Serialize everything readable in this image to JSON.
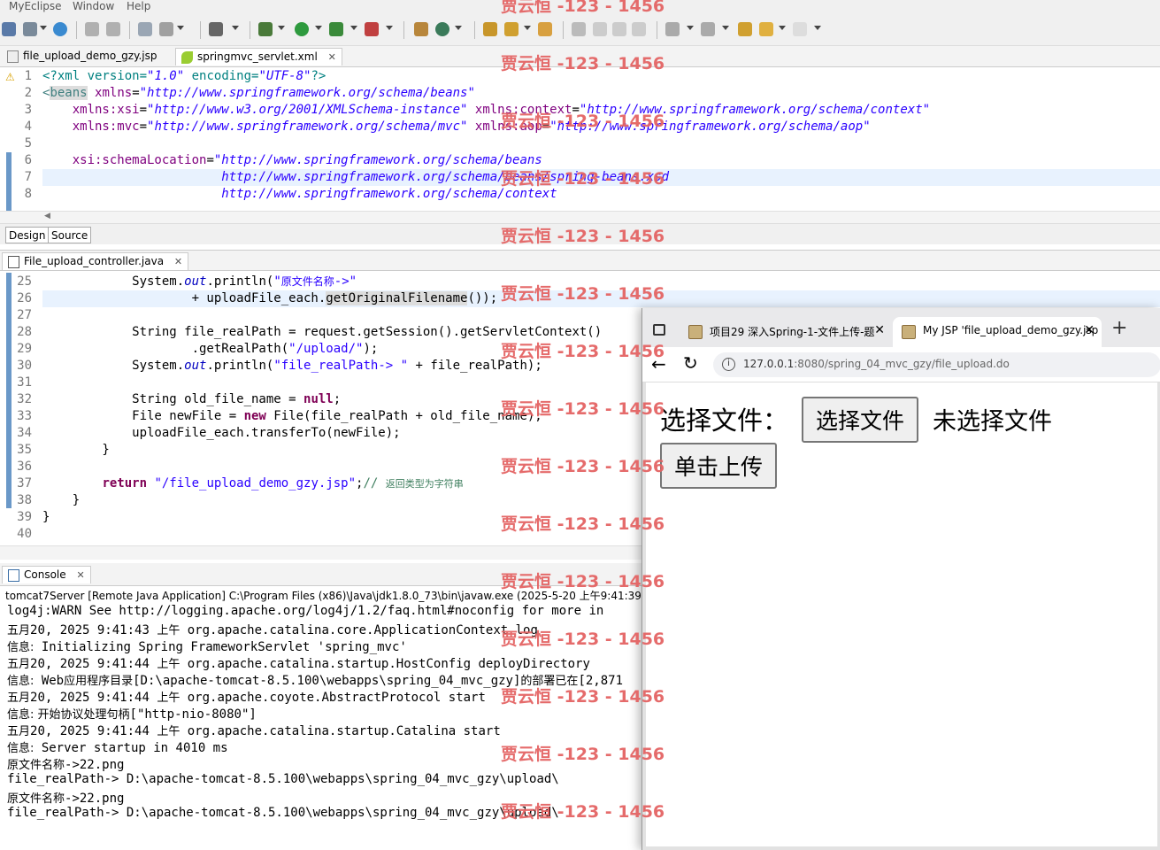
{
  "menubar": {
    "items": [
      "MyEclipse",
      "Window",
      "Help"
    ]
  },
  "xml_editor": {
    "tabs": [
      {
        "label": "file_upload_demo_gzy.jsp",
        "active": false
      },
      {
        "label": "springmvc_servlet.xml",
        "active": true
      }
    ],
    "lines": [
      {
        "n": "1",
        "html": "<span class=\"xdecl\">&lt;?xml version=</span><span class=\"xval\">\"1.0\"</span><span class=\"xdecl\"> encoding=</span><span class=\"xval\">\"UTF-8\"</span><span class=\"xdecl\">?&gt;</span>"
      },
      {
        "n": "2",
        "html": "<span class=\"xtag\">&lt;</span><span class=\"xtag\" style=\"background:#ddd\">beans</span> <span class=\"xattr\">xmlns</span>=<span class=\"xval\">\"http://www.springframework.org/schema/beans\"</span>"
      },
      {
        "n": "3",
        "html": "    <span class=\"xattr\">xmlns:xsi</span>=<span class=\"xval\">\"http://www.w3.org/2001/XMLSchema-instance\"</span> <span class=\"xattr\">xmlns:context</span>=<span class=\"xval\">\"http://www.springframework.org/schema/context\"</span>"
      },
      {
        "n": "4",
        "html": "    <span class=\"xattr\">xmlns:mvc</span>=<span class=\"xval\">\"http://www.springframework.org/schema/mvc\"</span> <span class=\"xattr\">xmlns:aop</span>=<span class=\"xval\">\"http://www.springframework.org/schema/aop\"</span>"
      },
      {
        "n": "5",
        "html": ""
      },
      {
        "n": "6",
        "html": "    <span class=\"xattr\">xsi:schemaLocation</span>=<span class=\"xval\">\"http://www.springframework.org/schema/beans</span>"
      },
      {
        "n": "7",
        "html": "                        <span class=\"xval\">http://www.springframework.org/schema/beans/spring-beans.xsd</span>"
      },
      {
        "n": "8",
        "html": "                        <span class=\"xval\">http://www.springframework.org/schema/context</span>"
      }
    ],
    "bottom_tabs": [
      "Design",
      "Source"
    ]
  },
  "java_editor": {
    "tab_label": "File_upload_controller.java",
    "lines": [
      {
        "n": "25",
        "html": "            System.<span class=\"fld\">out</span>.println(<span class=\"str\">\"<span class=\"cjk\">原文件名称</span>-&gt;\"</span>"
      },
      {
        "n": "26",
        "html": "                    + uploadFile_each.<span style=\"background:#ddd\">getOriginalFilename</span>());"
      },
      {
        "n": "27",
        "html": ""
      },
      {
        "n": "28",
        "html": "            String file_realPath = request.getSession().getServletContext()"
      },
      {
        "n": "29",
        "html": "                    .getRealPath(<span class=\"str\">\"/upload/\"</span>);"
      },
      {
        "n": "30",
        "html": "            System.<span class=\"fld\">out</span>.println(<span class=\"str\">\"file_realPath-&gt; \"</span> + file_realPath);"
      },
      {
        "n": "31",
        "html": ""
      },
      {
        "n": "32",
        "html": "            String old_file_name = <span class=\"kw\">null</span>;"
      },
      {
        "n": "33",
        "html": "            File newFile = <span class=\"kw\">new</span> File(file_realPath + old_file_name);"
      },
      {
        "n": "34",
        "html": "            uploadFile_each.transferTo(newFile);"
      },
      {
        "n": "35",
        "html": "        }"
      },
      {
        "n": "36",
        "html": ""
      },
      {
        "n": "37",
        "html": "        <span class=\"kw\">return</span> <span class=\"str\">\"/file_upload_demo_gzy.jsp\"</span>;<span class=\"cmt\">// <span class=\"cjk\" style=\"font-size:11px\">返回类型为字符串</span></span>"
      },
      {
        "n": "38",
        "html": "    }"
      },
      {
        "n": "39",
        "html": "}"
      },
      {
        "n": "40",
        "html": ""
      }
    ]
  },
  "console": {
    "tab_label": "Console",
    "description": "tomcat7Server [Remote Java Application] C:\\Program Files (x86)\\Java\\jdk1.8.0_73\\bin\\javaw.exe  (2025-5-20 上午9:41:39)",
    "lines": [
      {
        "html": "log4j:WARN See http://logging.apache.org/log4j/1.2/faq.html#noconfig for more in"
      },
      {
        "html": "<span class=\"cjk\">五月</span>20, 2025 9:41:43 <span class=\"cjk\">上午</span> org.apache.catalina.core.ApplicationContext log"
      },
      {
        "html": "<span class=\"cjk\">信息:</span> Initializing Spring FrameworkServlet 'spring_mvc'"
      },
      {
        "html": "<span class=\"cjk\">五月</span>20, 2025 9:41:44 <span class=\"cjk\">上午</span> org.apache.catalina.startup.HostConfig deployDirectory"
      },
      {
        "html": "<span class=\"cjk\">信息:</span> Web<span class=\"cjk\">应用程序目录</span>[D:\\apache-tomcat-8.5.100\\webapps\\spring_04_mvc_gzy]<span class=\"cjk\">的部署已在</span>[2,871"
      },
      {
        "html": "<span class=\"cjk\">五月</span>20, 2025 9:41:44 <span class=\"cjk\">上午</span> org.apache.coyote.AbstractProtocol start"
      },
      {
        "html": "<span class=\"cjk\">信息: 开始协议处理句柄</span>[\"http-nio-8080\"]"
      },
      {
        "html": "<span class=\"cjk\">五月</span>20, 2025 9:41:44 <span class=\"cjk\">上午</span> org.apache.catalina.startup.Catalina start"
      },
      {
        "html": "<span class=\"cjk\">信息:</span> Server startup in 4010 ms"
      },
      {
        "html": "<span class=\"cjk\">原文件名称</span>-&gt;22.png"
      },
      {
        "html": "file_realPath-&gt; D:\\apache-tomcat-8.5.100\\webapps\\spring_04_mvc_gzy\\upload\\"
      },
      {
        "html": "<span class=\"cjk\">原文件名称</span>-&gt;22.png"
      },
      {
        "html": "file_realPath-&gt; D:\\apache-tomcat-8.5.100\\webapps\\spring_04_mvc_gzy\\upload\\"
      }
    ]
  },
  "browser": {
    "tabs": [
      {
        "label": "项目29 深入Spring-1-文件上传-题",
        "active": false
      },
      {
        "label": "My JSP 'file_upload_demo_gzy.jsp",
        "active": true
      }
    ],
    "new_tab": "+",
    "url_host": "127.0.0.1",
    "url_rest": ":8080/spring_04_mvc_gzy/file_upload.do",
    "form": {
      "label": "选择文件：",
      "choose_button": "选择文件",
      "no_file_text": "未选择文件",
      "submit_button": "单击上传"
    }
  },
  "watermark": "贾云恒 -123 - 1456"
}
